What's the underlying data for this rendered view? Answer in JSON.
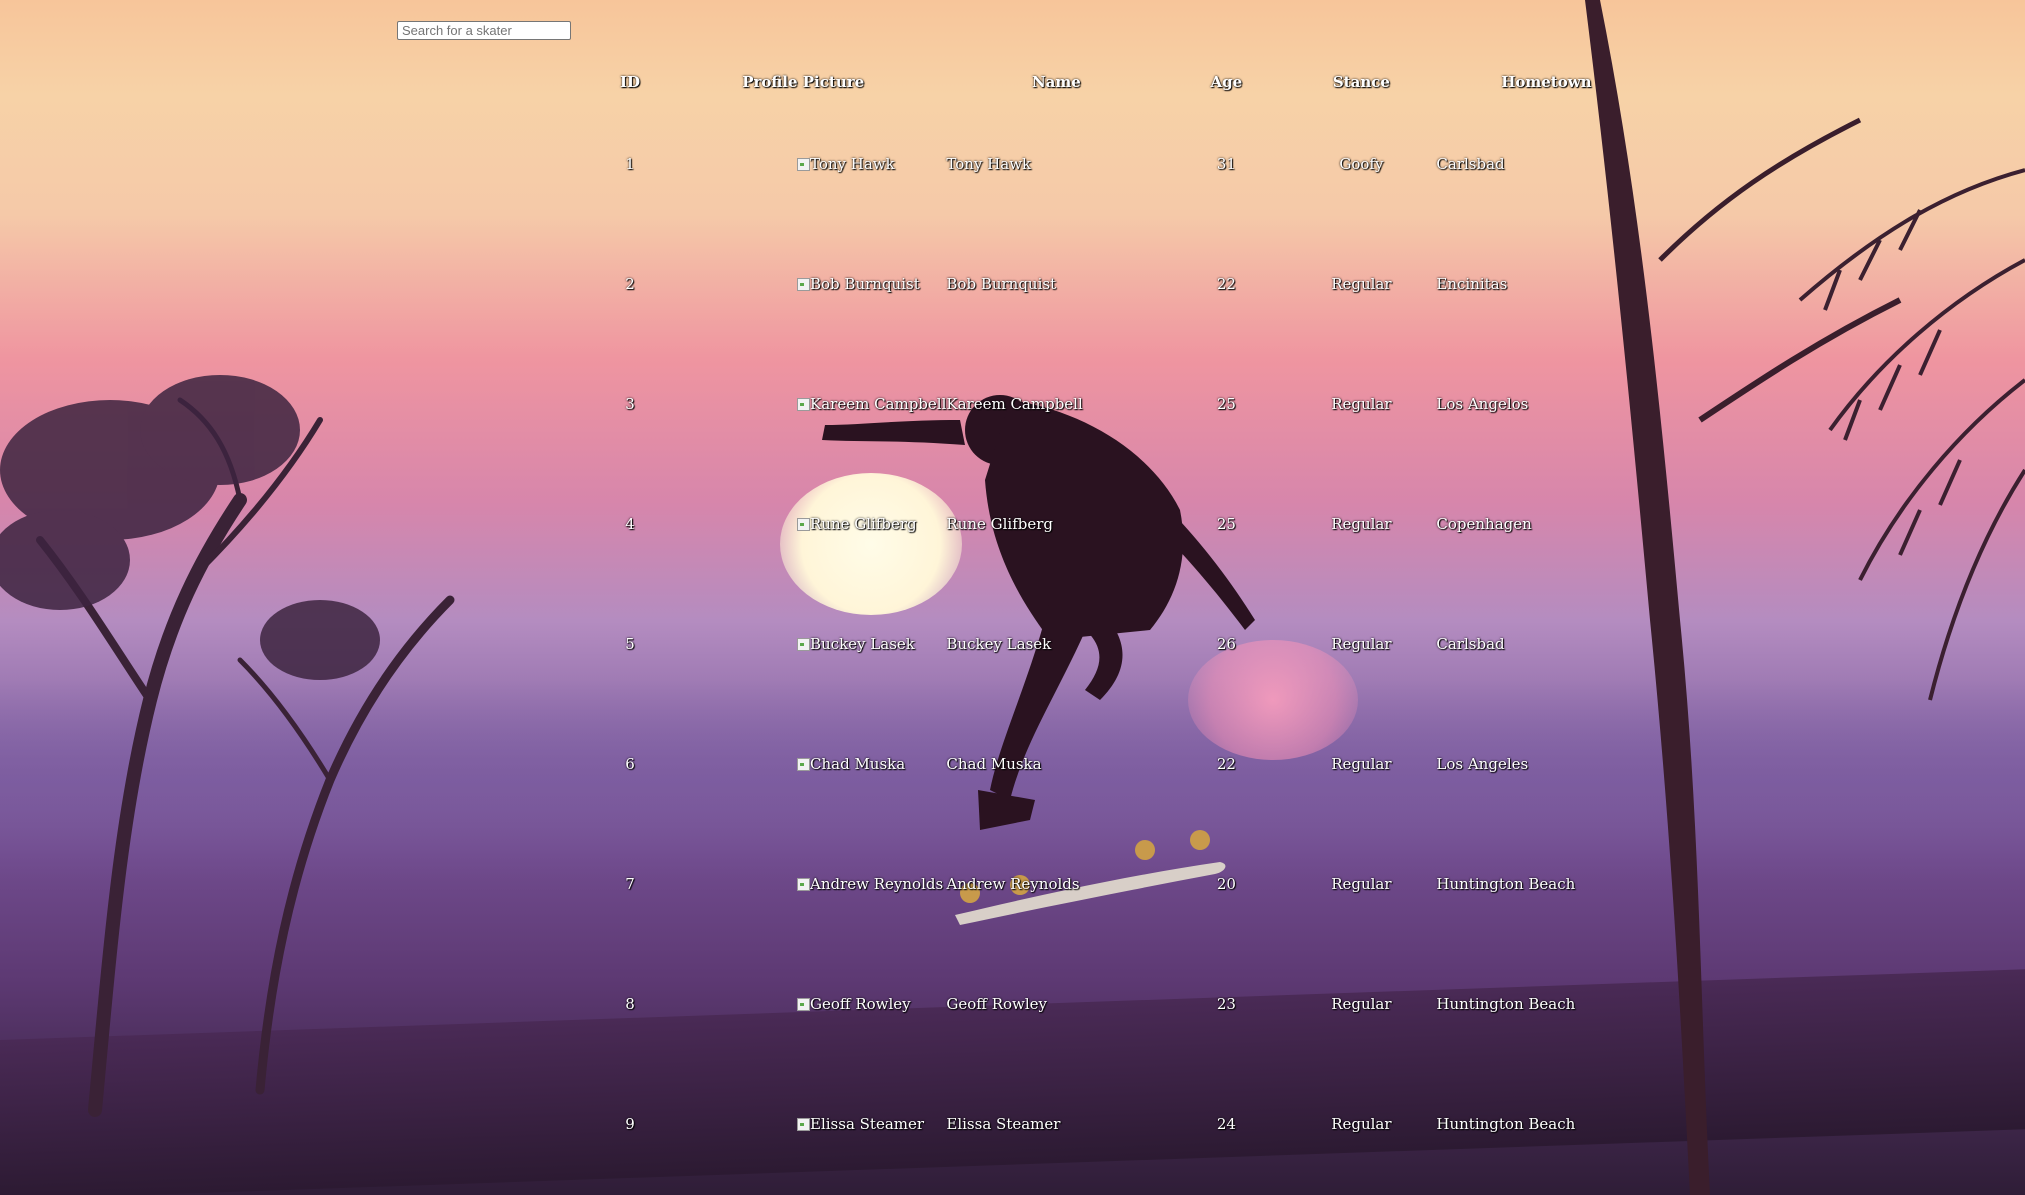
{
  "search": {
    "placeholder": "Search for a skater"
  },
  "table": {
    "headers": [
      "ID",
      "Profile Picture",
      "Name",
      "Age",
      "Stance",
      "Hometown"
    ],
    "rows": [
      {
        "id": "1",
        "picture_alt": "Tony Hawk",
        "name": "Tony Hawk",
        "age": "31",
        "stance": "Goofy",
        "hometown": "Carlsbad"
      },
      {
        "id": "2",
        "picture_alt": "Bob Burnquist",
        "name": "Bob Burnquist",
        "age": "22",
        "stance": "Regular",
        "hometown": "Encinitas"
      },
      {
        "id": "3",
        "picture_alt": "Kareem Campbell",
        "name": "Kareem Campbell",
        "age": "25",
        "stance": "Regular",
        "hometown": "Los Angelos"
      },
      {
        "id": "4",
        "picture_alt": "Rune Glifberg",
        "name": "Rune Glifberg",
        "age": "25",
        "stance": "Regular",
        "hometown": "Copenhagen"
      },
      {
        "id": "5",
        "picture_alt": "Buckey Lasek",
        "name": "Buckey Lasek",
        "age": "26",
        "stance": "Regular",
        "hometown": "Carlsbad"
      },
      {
        "id": "6",
        "picture_alt": "Chad Muska",
        "name": "Chad Muska",
        "age": "22",
        "stance": "Regular",
        "hometown": "Los Angeles"
      },
      {
        "id": "7",
        "picture_alt": "Andrew Reynolds",
        "name": "Andrew Reynolds",
        "age": "20",
        "stance": "Regular",
        "hometown": "Huntington Beach"
      },
      {
        "id": "8",
        "picture_alt": "Geoff Rowley",
        "name": "Geoff Rowley",
        "age": "23",
        "stance": "Regular",
        "hometown": "Huntington Beach"
      },
      {
        "id": "9",
        "picture_alt": "Elissa Steamer",
        "name": "Elissa Steamer",
        "age": "24",
        "stance": "Regular",
        "hometown": "Huntington Beach"
      }
    ]
  }
}
